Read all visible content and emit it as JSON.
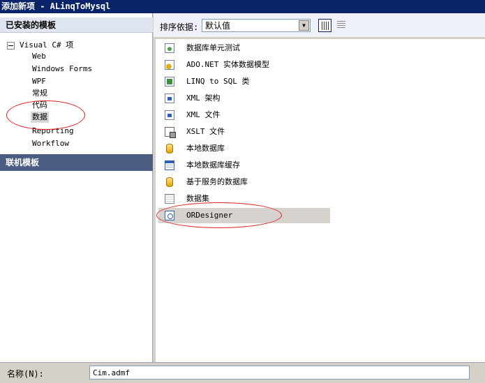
{
  "window": {
    "title": "添加新项 - ALinqToMysql"
  },
  "sidebar": {
    "installed_header": "已安装的模板",
    "tree_root": "Visual C# 项",
    "items": [
      {
        "label": "Web"
      },
      {
        "label": "Windows Forms"
      },
      {
        "label": "WPF"
      },
      {
        "label": "常规"
      },
      {
        "label": "代码"
      },
      {
        "label": "数据",
        "selected": true
      },
      {
        "label": "Reporting"
      },
      {
        "label": "Workflow"
      }
    ],
    "online_header": "联机模板"
  },
  "toolbar": {
    "sort_label": "排序依据:",
    "sort_value": "默认值",
    "view_icons": [
      "grid-view-icon",
      "list-view-icon"
    ]
  },
  "templates": [
    {
      "label": "数据库单元测试",
      "icon": "database-unit-test-icon"
    },
    {
      "label": "ADO.NET 实体数据模型",
      "icon": "entity-model-icon"
    },
    {
      "label": "LINQ to SQL 类",
      "icon": "linq-to-sql-icon"
    },
    {
      "label": "XML 架构",
      "icon": "xml-schema-icon"
    },
    {
      "label": "XML 文件",
      "icon": "xml-file-icon"
    },
    {
      "label": "XSLT 文件",
      "icon": "xslt-file-icon"
    },
    {
      "label": "本地数据库",
      "icon": "local-database-icon"
    },
    {
      "label": "本地数据库缓存",
      "icon": "local-database-cache-icon"
    },
    {
      "label": "基于服务的数据库",
      "icon": "service-database-icon"
    },
    {
      "label": "数据集",
      "icon": "dataset-icon"
    },
    {
      "label": "ORDesigner",
      "icon": "or-designer-icon",
      "selected": true
    }
  ],
  "name_field": {
    "label": "名称(N):",
    "value": "Cim.admf"
  },
  "colors": {
    "titlebar": "#0a246a",
    "section_header": "#4a5c80",
    "annotation": "#e02020",
    "selected": "#d6d3ce"
  }
}
